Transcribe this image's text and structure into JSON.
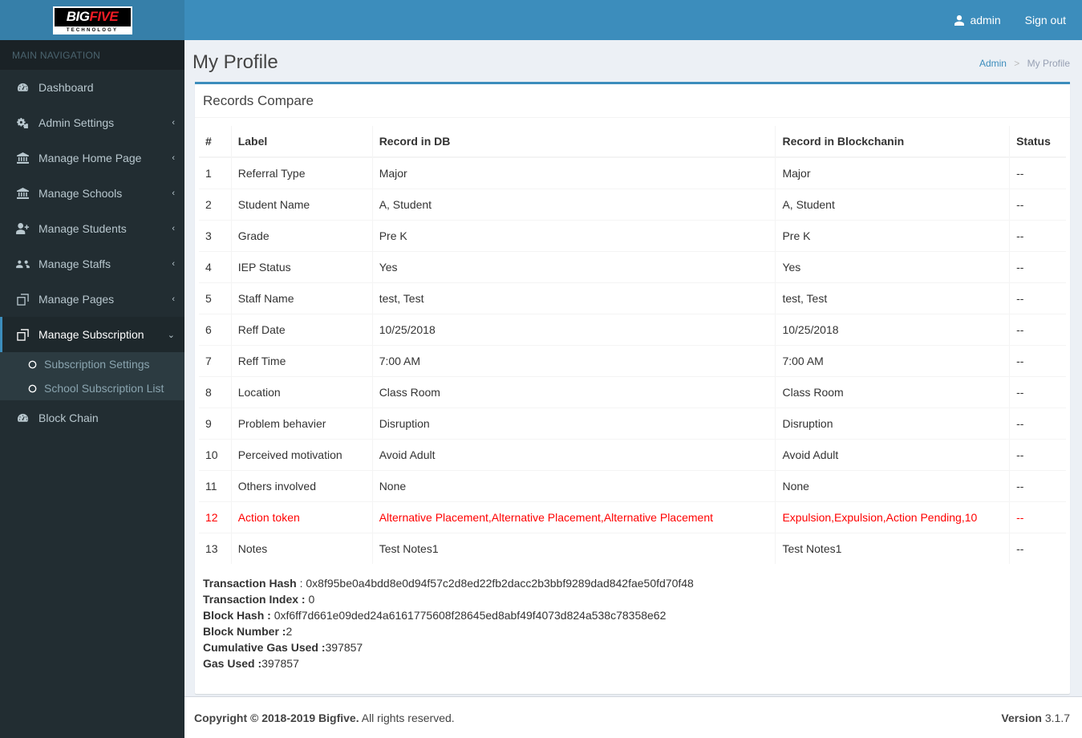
{
  "brand": {
    "logo_primary": "BIG",
    "logo_accent": "FIVE",
    "logo_sub": "TECHNOLOGY"
  },
  "colors": {
    "navbar": "#3c8dbc",
    "logo_box": "#367fa9",
    "sidebar": "#222d32",
    "sidebar_dark": "#1a2226",
    "submenu": "#2c3b41",
    "accent": "#3c8dbc",
    "mismatch": "#ff0000",
    "body_bg": "#ecf0f5"
  },
  "navbar": {
    "user_label": "admin",
    "user_icon": "user-icon",
    "signout_label": "Sign out"
  },
  "sidebar": {
    "header": "MAIN NAVIGATION",
    "items": [
      {
        "label": "Dashboard",
        "icon": "dashboard-icon",
        "arrow": "",
        "active": false
      },
      {
        "label": "Admin Settings",
        "icon": "gears-icon",
        "arrow": "‹",
        "active": false
      },
      {
        "label": "Manage Home Page",
        "icon": "bank-icon",
        "arrow": "‹",
        "active": false
      },
      {
        "label": "Manage Schools",
        "icon": "bank-icon",
        "arrow": "‹",
        "active": false
      },
      {
        "label": "Manage Students",
        "icon": "user-plus-icon",
        "arrow": "‹",
        "active": false
      },
      {
        "label": "Manage Staffs",
        "icon": "users-icon",
        "arrow": "‹",
        "active": false
      },
      {
        "label": "Manage Pages",
        "icon": "clone-icon",
        "arrow": "‹",
        "active": false
      },
      {
        "label": "Manage Subscription",
        "icon": "clone-icon",
        "arrow": "⌄",
        "active": true
      },
      {
        "label": "Block Chain",
        "icon": "dashboard-icon",
        "arrow": "",
        "active": false
      }
    ],
    "submenu": {
      "parent_index": 7,
      "items": [
        {
          "label": "Subscription Settings",
          "icon": "circle-o-icon"
        },
        {
          "label": "School Subscription List",
          "icon": "circle-o-icon"
        }
      ]
    }
  },
  "page": {
    "title": "My Profile",
    "breadcrumb": [
      {
        "label": "Admin",
        "link": true
      },
      {
        "label": "My Profile",
        "link": false
      }
    ],
    "breadcrumb_separator": ">"
  },
  "box": {
    "title": "Records Compare"
  },
  "table": {
    "columns": [
      "#",
      "Label",
      "Record in DB",
      "Record in Blockchanin",
      "Status"
    ],
    "rows": [
      {
        "index": "1",
        "label": "Referral Type",
        "db": "Major",
        "bc": "Major",
        "status": "--",
        "mismatch": false
      },
      {
        "index": "2",
        "label": "Student Name",
        "db": "A, Student",
        "bc": "A, Student",
        "status": "--",
        "mismatch": false
      },
      {
        "index": "3",
        "label": "Grade",
        "db": "Pre K",
        "bc": "Pre K",
        "status": "--",
        "mismatch": false
      },
      {
        "index": "4",
        "label": "IEP Status",
        "db": "Yes",
        "bc": "Yes",
        "status": "--",
        "mismatch": false
      },
      {
        "index": "5",
        "label": "Staff Name",
        "db": "test, Test",
        "bc": "test, Test",
        "status": "--",
        "mismatch": false
      },
      {
        "index": "6",
        "label": "Reff Date",
        "db": "10/25/2018",
        "bc": "10/25/2018",
        "status": "--",
        "mismatch": false
      },
      {
        "index": "7",
        "label": "Reff Time",
        "db": "7:00 AM",
        "bc": "7:00 AM",
        "status": "--",
        "mismatch": false
      },
      {
        "index": "8",
        "label": "Location",
        "db": "Class Room",
        "bc": "Class Room",
        "status": "--",
        "mismatch": false
      },
      {
        "index": "9",
        "label": "Problem behavier",
        "db": "Disruption",
        "bc": "Disruption",
        "status": "--",
        "mismatch": false
      },
      {
        "index": "10",
        "label": "Perceived motivation",
        "db": "Avoid Adult",
        "bc": "Avoid Adult",
        "status": "--",
        "mismatch": false
      },
      {
        "index": "11",
        "label": "Others involved",
        "db": "None",
        "bc": "None",
        "status": "--",
        "mismatch": false
      },
      {
        "index": "12",
        "label": "Action token",
        "db": "Alternative Placement,Alternative Placement,Alternative Placement",
        "bc": "Expulsion,Expulsion,Action Pending,10",
        "status": "--",
        "mismatch": true
      },
      {
        "index": "13",
        "label": "Notes",
        "db": "Test Notes1",
        "bc": "Test Notes1",
        "status": "--",
        "mismatch": false
      }
    ]
  },
  "transaction": {
    "hash_label": "Transaction Hash",
    "hash_sep": " : ",
    "hash_value": "0x8f95be0a4bdd8e0d94f57c2d8ed22fb2dacc2b3bbf9289dad842fae50fd70f48",
    "index_label": "Transaction Index :",
    "index_value": " 0",
    "block_hash_label": "Block Hash :",
    "block_hash_value": " 0xf6ff7d661e09ded24a6161775608f28645ed8abf49f4073d824a538c78358e62",
    "block_number_label": "Block Number :",
    "block_number_value": "2",
    "cumulative_gas_label": "Cumulative Gas Used :",
    "cumulative_gas_value": "397857",
    "gas_used_label": "Gas Used :",
    "gas_used_value": "397857"
  },
  "footer": {
    "copyright_strong": "Copyright © 2018-2019 Bigfive.",
    "copyright_rest": " All rights reserved.",
    "version_label": "Version",
    "version_value": " 3.1.7"
  }
}
